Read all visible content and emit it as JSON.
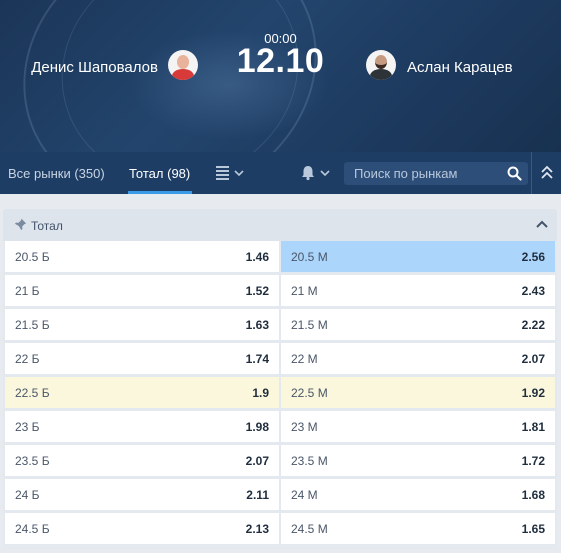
{
  "match": {
    "player_left": "Денис Шаповалов",
    "player_right": "Аслан Карацев",
    "time": "00:00",
    "score": "12.10"
  },
  "nav": {
    "tabs": [
      {
        "label": "Все рынки",
        "count": "(350)",
        "active": false
      },
      {
        "label": "Тотал",
        "count": "(98)",
        "active": true
      }
    ],
    "search_placeholder": "Поиск по рынкам",
    "icons": [
      "list-icon",
      "chevron-down-icon",
      "bell-icon",
      "search-icon",
      "double-chevron-up-icon"
    ]
  },
  "market": {
    "title": "Тотал",
    "rows": [
      {
        "over_label": "20.5 Б",
        "over_odds": "1.46",
        "under_label": "20.5 М",
        "under_odds": "2.56",
        "highlight": "under"
      },
      {
        "over_label": "21 Б",
        "over_odds": "1.52",
        "under_label": "21 М",
        "under_odds": "2.43",
        "highlight": ""
      },
      {
        "over_label": "21.5 Б",
        "over_odds": "1.63",
        "under_label": "21.5 М",
        "under_odds": "2.22",
        "highlight": ""
      },
      {
        "over_label": "22 Б",
        "over_odds": "1.74",
        "under_label": "22 М",
        "under_odds": "2.07",
        "highlight": ""
      },
      {
        "over_label": "22.5 Б",
        "over_odds": "1.9",
        "under_label": "22.5 М",
        "under_odds": "1.92",
        "highlight": "both"
      },
      {
        "over_label": "23 Б",
        "over_odds": "1.98",
        "under_label": "23 М",
        "under_odds": "1.81",
        "highlight": ""
      },
      {
        "over_label": "23.5 Б",
        "over_odds": "2.07",
        "under_label": "23.5 М",
        "under_odds": "1.72",
        "highlight": ""
      },
      {
        "over_label": "24 Б",
        "over_odds": "2.11",
        "under_label": "24 М",
        "under_odds": "1.68",
        "highlight": ""
      },
      {
        "over_label": "24.5 Б",
        "over_odds": "2.13",
        "under_label": "24.5 М",
        "under_odds": "1.65",
        "highlight": ""
      }
    ]
  },
  "colors": {
    "header_bg": "#1e3d64",
    "active_underline": "#3b9ae8",
    "highlight_blue": "#acd5fb",
    "highlight_yellow": "#fbf7dd"
  }
}
